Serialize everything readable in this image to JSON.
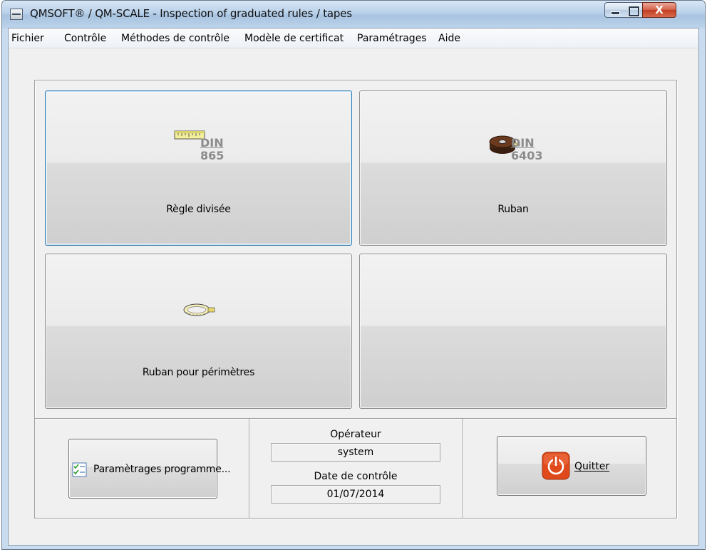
{
  "window": {
    "title": "QMSOFT® / QM-SCALE - Inspection of graduated rules / tapes",
    "close_glyph": "X"
  },
  "menu": [
    {
      "label": "Fichier"
    },
    {
      "label": "Contrôle"
    },
    {
      "label": "Méthodes de contrôle"
    },
    {
      "label": "Modèle de certificat"
    },
    {
      "label": "Paramétrages"
    },
    {
      "label": "Aide"
    }
  ],
  "tiles": {
    "rule": {
      "label": "Règle divisée",
      "din_top": "DIN",
      "din_num": "865",
      "icon": "ruler-icon"
    },
    "tape": {
      "label": "Ruban",
      "din_top": "DIN",
      "din_num": "6403",
      "icon": "tape-reel-icon"
    },
    "perimeter": {
      "label": "Ruban pour périmètres",
      "icon": "perimeter-tape-icon"
    },
    "empty": {
      "label": ""
    }
  },
  "bottom": {
    "settings_button": "Paramètrages programme...",
    "operator_label": "Opérateur",
    "operator_value": "system",
    "date_label": "Date de contrôle",
    "date_value": "01/07/2014",
    "quit_button": "Quitter"
  },
  "colors": {
    "focus_border": "#3c7fb1",
    "quit_icon": "#e04a1b"
  }
}
